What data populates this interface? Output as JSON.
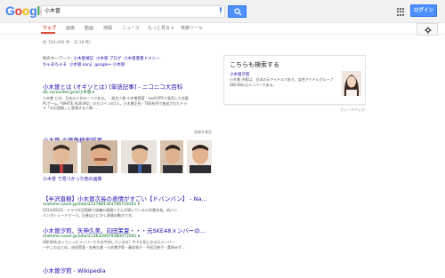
{
  "header": {
    "logo": [
      "G",
      "o",
      "o",
      "g",
      "l",
      "e"
    ],
    "search_query": "小木曽",
    "login_label": "ログイン"
  },
  "tabs": {
    "items": [
      "ウェブ",
      "画像",
      "動画",
      "地図",
      "ニュース",
      "もっと見る ▾",
      "検索ツール"
    ]
  },
  "result_stats": "約 764,000 件 （0.28 秒）",
  "related": {
    "prefix": "他のキーワード:",
    "items": [
      "小木曽靖記",
      "小木曽 ブログ",
      "小木曽豊豊ドメシー",
      "ちゃあちゃそ",
      "小木曽 kanji",
      "google+ 小木曽"
    ]
  },
  "results": [
    {
      "title": "小木曽とは (オギソとは) [単語記事] - ニコニコ大百科",
      "url": "dic.nicovideo.jp/a/小木曽 ▾",
      "snippet": [
        "小木曽 とは、日本の人名の一つである。　架空人物 小木曽雪菜 - LeafがPSで発売した恋愛",
        "PCゲーム「WHITE ALBUM2」のヒロインの1人。小木曽正也 - TBS系列で放送されたドラ",
        "マ「半沢直樹」に登場する人物 ..."
      ]
    },
    {
      "title": "【半沢直樹】小木曽次長の表情がすごい【ドバンバン】 - Na...",
      "url": "matome.naver.jp/odai/2137881303706719301 ▾",
      "snippet": [
        "2013/09/22 - ドラマ半沢直樹で誤嫌の顔顔人さんが演じている小木曽次長。机バン",
        "バンがトレードマーク。圧巻はとにかく表情の動きです。"
      ]
    },
    {
      "title": "小木曽汐莉、矢神久美、向田茉夏・・・元SKE48メンバーの...",
      "url": "matome.naver.jp/odai/2136329979380071001 ▾",
      "snippet": [
        "SKE48を去っていったメンバーたちは今何しているの？今でも気になる元メンバー",
        "ーやこのまとめ。向田茉夏・矢神久美・小木曽汐莉・秦佐和子・平松可奈子・桑原みず..."
      ]
    },
    {
      "title": "小木曽汐莉 - Wikipedia",
      "url": "",
      "snippet": []
    }
  ],
  "images": {
    "title": "小木曽 の画像検索結果",
    "report": "画像を報告",
    "more": "小木曽 で見つかった他の画像"
  },
  "knowledge_panel": {
    "title": "こちらも検索する",
    "name": "小木曽汐莉",
    "description": "小木曽 汐莉は、日本の元アイドルであり、女性アイドルグループSKE48の元メンバーである。 ",
    "feedback": "フィードバック"
  },
  "colors": {
    "link": "#1a0dab",
    "url_green": "#006621",
    "accent_red": "#dd4b39",
    "button_blue": "#4d90fe"
  }
}
